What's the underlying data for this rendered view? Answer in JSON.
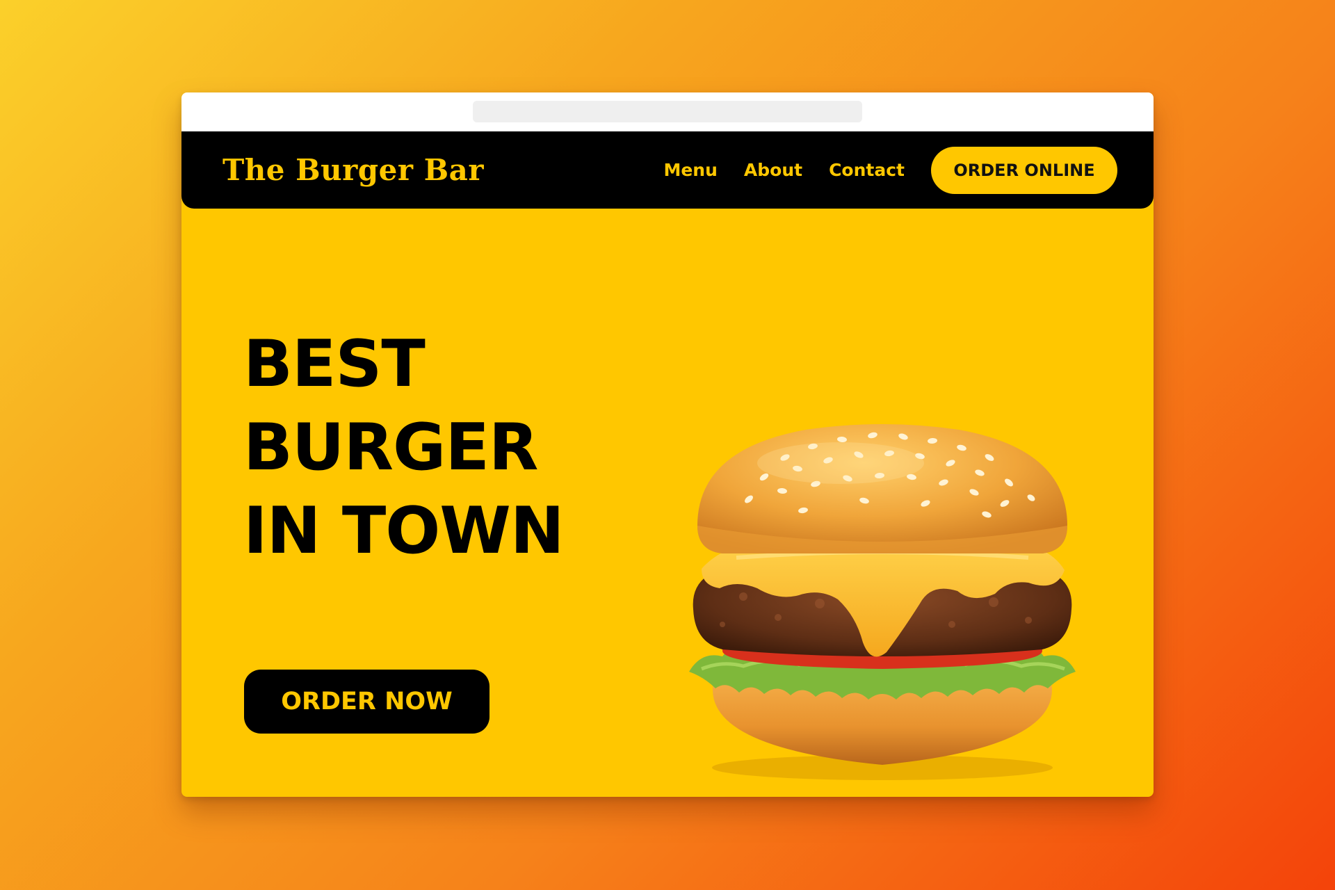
{
  "site": {
    "brand": "The Burger Bar",
    "nav": {
      "links": [
        "Menu",
        "About",
        "Contact"
      ],
      "cta_label": "ORDER ONLINE"
    }
  },
  "hero": {
    "heading_lines": [
      "BEST",
      "BURGER",
      "IN TOWN"
    ],
    "cta_label": "ORDER NOW",
    "image": "cheeseburger-photo"
  },
  "colors": {
    "brand_yellow": "#ffc700",
    "nav_black": "#000000",
    "address_bar": "#efefef",
    "gradient_start": "#fbd02a",
    "gradient_end": "#f4430a"
  }
}
